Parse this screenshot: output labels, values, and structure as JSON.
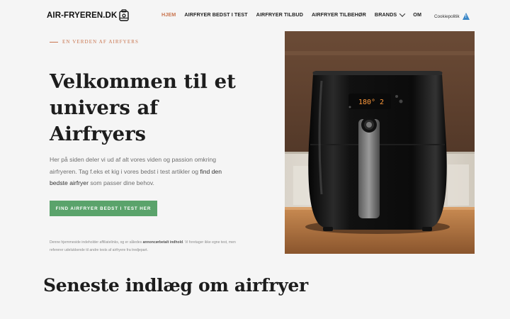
{
  "site": {
    "logo_text": "AIR-FRYEREN.DK"
  },
  "nav": {
    "items": [
      {
        "label": "HJEM",
        "active": true
      },
      {
        "label": "AIRFRYER BEDST I TEST",
        "active": false
      },
      {
        "label": "AIRFRYER TILBUD",
        "active": false
      },
      {
        "label": "AIRFRYER TILBEHØR",
        "active": false
      },
      {
        "label": "BRANDS",
        "active": false,
        "has_dropdown": true
      },
      {
        "label": "OM",
        "active": false
      }
    ],
    "cookie_label": "Cookiepolitik",
    "cookie_icon": "warning-icon"
  },
  "hero": {
    "eyebrow": "EN VERDEN AF AIRFYERS",
    "headline_1": "Velkommen til et",
    "headline_2": "univers af",
    "headline_3": "Airfryers",
    "lead_1": "Her på siden deler vi ud af alt vores viden og passion omkring airfryeren. Tag f.eks et kig i vores bedst i test artikler og ",
    "lead_link": "find den bedste airfryer",
    "lead_2": " som passer dine behov.",
    "cta_label": "FIND AIRFRYER BEDST I TEST HER",
    "disclaimer_1": "Denne hjemmeside indeholder affiliatelinks, og er således ",
    "disclaimer_bold": "annoncørbetalt indhold",
    "disclaimer_2": ". Vi foretager ikke egne test, men refererer udelukkende til andre tests af airfryere fra tredjepart."
  },
  "product_display": {
    "temperature": "180°",
    "time": "2"
  },
  "section": {
    "title": "Seneste indlæg om airfryer"
  },
  "colors": {
    "accent": "#c9754f",
    "button": "#5aa36b",
    "background": "#f5f5f5"
  }
}
